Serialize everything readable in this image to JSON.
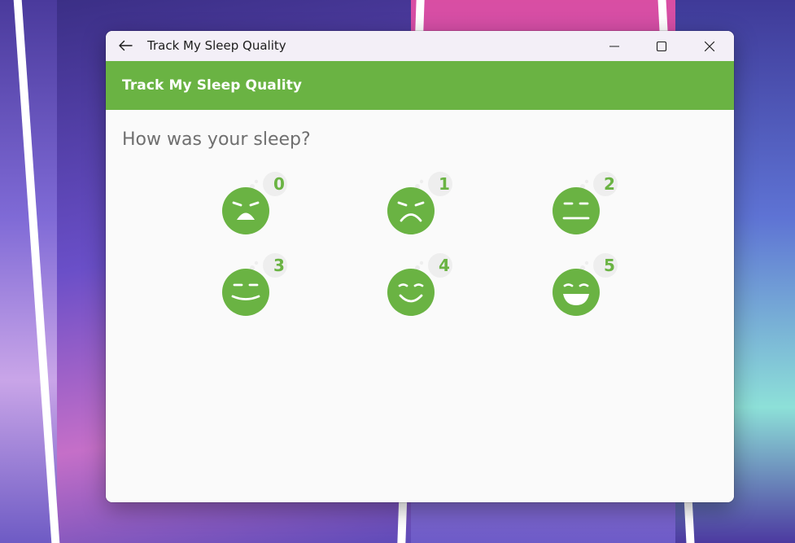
{
  "window": {
    "title": "Track My Sleep Quality"
  },
  "appbar": {
    "title": "Track My Sleep Quality"
  },
  "content": {
    "question": "How was your sleep?",
    "qualities": [
      {
        "value": "0",
        "icon": "sleep-quality-0-icon"
      },
      {
        "value": "1",
        "icon": "sleep-quality-1-icon"
      },
      {
        "value": "2",
        "icon": "sleep-quality-2-icon"
      },
      {
        "value": "3",
        "icon": "sleep-quality-3-icon"
      },
      {
        "value": "4",
        "icon": "sleep-quality-4-icon"
      },
      {
        "value": "5",
        "icon": "sleep-quality-5-icon"
      }
    ]
  },
  "colors": {
    "accent": "#6ab343",
    "titlebar": "#f3eff7",
    "background": "#fafafa",
    "question_text": "#6f6f6f",
    "badge": "#eeeeee"
  }
}
